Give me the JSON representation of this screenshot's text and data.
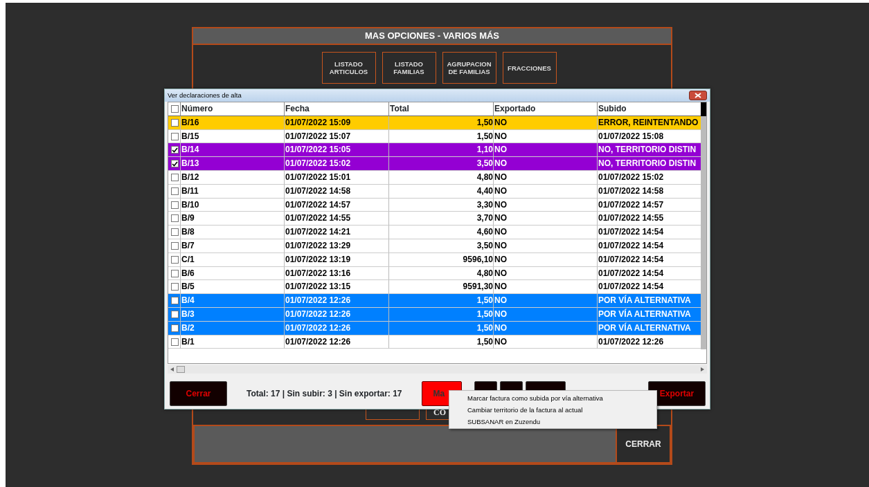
{
  "panel": {
    "title": "MAS OPCIONES - VARIOS MÁS",
    "buttons": [
      "LISTADO\nARTICULOS",
      "LISTADO\nFAMILIAS",
      "AGRUPACION\nDE FAMILIAS",
      "FRACCIONES"
    ],
    "lower_buttons": [
      {
        "kind": "covered"
      },
      {
        "kind": "labeled",
        "label": "CO"
      }
    ],
    "close_button": "CERRAR"
  },
  "dialog": {
    "title": "Ver declaraciones de alta",
    "select_all": {
      "checked": false
    },
    "table": {
      "columns": [
        "Número",
        "Fecha",
        "Total",
        "Exportado",
        "Subido"
      ],
      "rows": [
        {
          "cells": [
            "B/16",
            "01/07/2022 15:09",
            "1,50",
            "NO",
            "ERROR, REINTENTANDO"
          ],
          "checked": false,
          "color": "#ffcc00"
        },
        {
          "cells": [
            "B/15",
            "01/07/2022 15:07",
            "1,50",
            "NO",
            "01/07/2022 15:08"
          ],
          "checked": false,
          "color": "#ffffff"
        },
        {
          "cells": [
            "B/14",
            "01/07/2022 15:05",
            "1,10",
            "NO",
            "NO, TERRITORIO DISTIN"
          ],
          "checked": true,
          "color": "#9400d3"
        },
        {
          "cells": [
            "B/13",
            "01/07/2022 15:02",
            "3,50",
            "NO",
            "NO, TERRITORIO DISTIN"
          ],
          "checked": true,
          "color": "#9400d3"
        },
        {
          "cells": [
            "B/12",
            "01/07/2022 15:01",
            "4,80",
            "NO",
            "01/07/2022 15:02"
          ],
          "checked": false,
          "color": "#ffffff"
        },
        {
          "cells": [
            "B/11",
            "01/07/2022 14:58",
            "4,40",
            "NO",
            "01/07/2022 14:58"
          ],
          "checked": false,
          "color": "#ffffff"
        },
        {
          "cells": [
            "B/10",
            "01/07/2022 14:57",
            "3,30",
            "NO",
            "01/07/2022 14:57"
          ],
          "checked": false,
          "color": "#ffffff"
        },
        {
          "cells": [
            "B/9",
            "01/07/2022 14:55",
            "3,70",
            "NO",
            "01/07/2022 14:55"
          ],
          "checked": false,
          "color": "#ffffff"
        },
        {
          "cells": [
            "B/8",
            "01/07/2022 14:21",
            "4,60",
            "NO",
            "01/07/2022 14:54"
          ],
          "checked": false,
          "color": "#ffffff"
        },
        {
          "cells": [
            "B/7",
            "01/07/2022 13:29",
            "3,50",
            "NO",
            "01/07/2022 14:54"
          ],
          "checked": false,
          "color": "#ffffff"
        },
        {
          "cells": [
            "C/1",
            "01/07/2022 13:19",
            "9596,10",
            "NO",
            "01/07/2022 14:54"
          ],
          "checked": false,
          "color": "#ffffff"
        },
        {
          "cells": [
            "B/6",
            "01/07/2022 13:16",
            "4,80",
            "NO",
            "01/07/2022 14:54"
          ],
          "checked": false,
          "color": "#ffffff"
        },
        {
          "cells": [
            "B/5",
            "01/07/2022 13:15",
            "9591,30",
            "NO",
            "01/07/2022 14:54"
          ],
          "checked": false,
          "color": "#ffffff"
        },
        {
          "cells": [
            "B/4",
            "01/07/2022 12:26",
            "1,50",
            "NO",
            "POR VÍA ALTERNATIVA"
          ],
          "checked": false,
          "color": "#0080ff"
        },
        {
          "cells": [
            "B/3",
            "01/07/2022 12:26",
            "1,50",
            "NO",
            "POR VÍA ALTERNATIVA"
          ],
          "checked": false,
          "color": "#0080ff"
        },
        {
          "cells": [
            "B/2",
            "01/07/2022 12:26",
            "1,50",
            "NO",
            "POR VÍA ALTERNATIVA"
          ],
          "checked": false,
          "color": "#0080ff"
        },
        {
          "cells": [
            "B/1",
            "01/07/2022 12:26",
            "1,50",
            "NO",
            "01/07/2022 12:26"
          ],
          "checked": false,
          "color": "#ffffff"
        }
      ]
    },
    "footer": {
      "close_button": "Cerrar",
      "summary": "Total: 17 | Sin subir: 3 | Sin exportar: 17",
      "mark_button": "Ma",
      "export_button": "Exportar"
    }
  },
  "context_menu": {
    "items": [
      "Marcar factura como subida por vía alternativa",
      "Cambiar territorio de la factura al actual",
      "SUBSANAR en Zuzendu"
    ]
  }
}
